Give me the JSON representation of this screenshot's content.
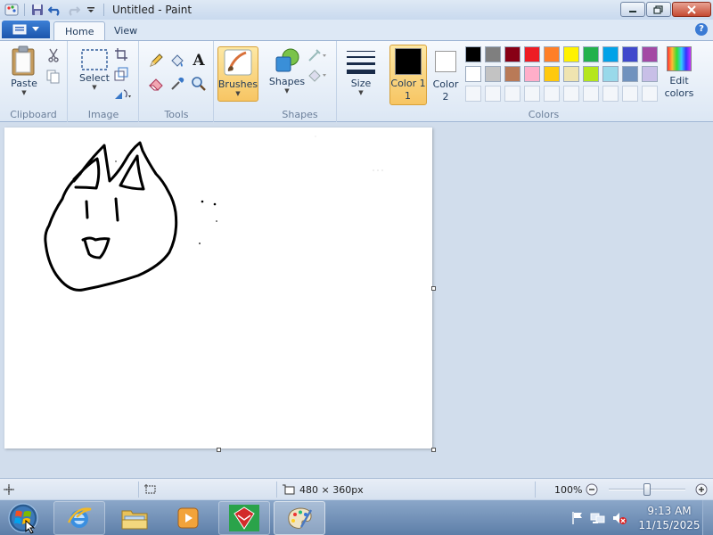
{
  "window": {
    "title": "Untitled - Paint"
  },
  "tabs": {
    "home": "Home",
    "view": "View"
  },
  "help_label": "?",
  "ribbon": {
    "clipboard": {
      "label": "Clipboard",
      "paste": "Paste"
    },
    "image": {
      "label": "Image",
      "select": "Select"
    },
    "tools": {
      "label": "Tools",
      "text_tool": "A"
    },
    "brushes": {
      "label": "Brushes"
    },
    "shapes": {
      "label": "Shapes",
      "button": "Shapes"
    },
    "size": {
      "label": "Size"
    },
    "colors": {
      "label": "Colors",
      "color1": "Color 1",
      "color1_num": "1",
      "color1_value": "#000000",
      "color2": "Color",
      "color2_num": "2",
      "color2_value": "#ffffff",
      "edit": "Edit",
      "edit2": "colors",
      "palette_row1": [
        "#000000",
        "#7f7f7f",
        "#880015",
        "#ed1c24",
        "#ff7f27",
        "#fff200",
        "#22b14c",
        "#00a2e8",
        "#3f48cc",
        "#a349a4"
      ],
      "palette_row2": [
        "#ffffff",
        "#c3c3c3",
        "#b97a57",
        "#ffaec9",
        "#ffc90e",
        "#efe4b0",
        "#b5e61d",
        "#99d9ea",
        "#7092be",
        "#c8bfe7"
      ]
    }
  },
  "status": {
    "canvas_size": "480 × 360px",
    "zoom": "100%",
    "zoom_level": 1.0
  },
  "taskbar": {
    "clock_time": "9:13 AM",
    "clock_date": "11/15/2025"
  }
}
